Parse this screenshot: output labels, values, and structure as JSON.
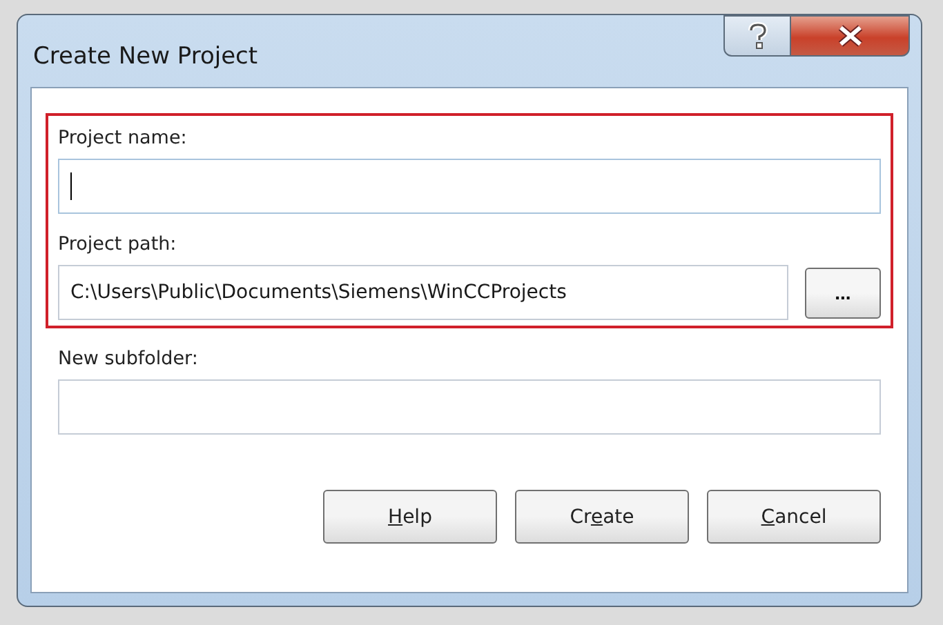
{
  "window": {
    "title": "Create New Project",
    "title_buttons": [
      {
        "kind": "help"
      },
      {
        "kind": "close"
      }
    ]
  },
  "sections": [
    {
      "highlighted": true,
      "fields": [
        {
          "label": "Project name:",
          "focused": true,
          "browse": false
        },
        {
          "label": "Project path:",
          "value": "C:\\Users\\Public\\Documents\\Siemens\\WinCCProjects",
          "focused": false,
          "browse": true,
          "browse_label": "..."
        }
      ]
    },
    {
      "highlighted": false,
      "fields": [
        {
          "label": "New subfolder:",
          "focused": false,
          "browse": false
        }
      ]
    }
  ],
  "buttons": [
    {
      "key": "H",
      "after": "elp"
    },
    {
      "before": "Cr",
      "key": "e",
      "after": "ate"
    },
    {
      "key": "C",
      "after": "ancel"
    }
  ]
}
